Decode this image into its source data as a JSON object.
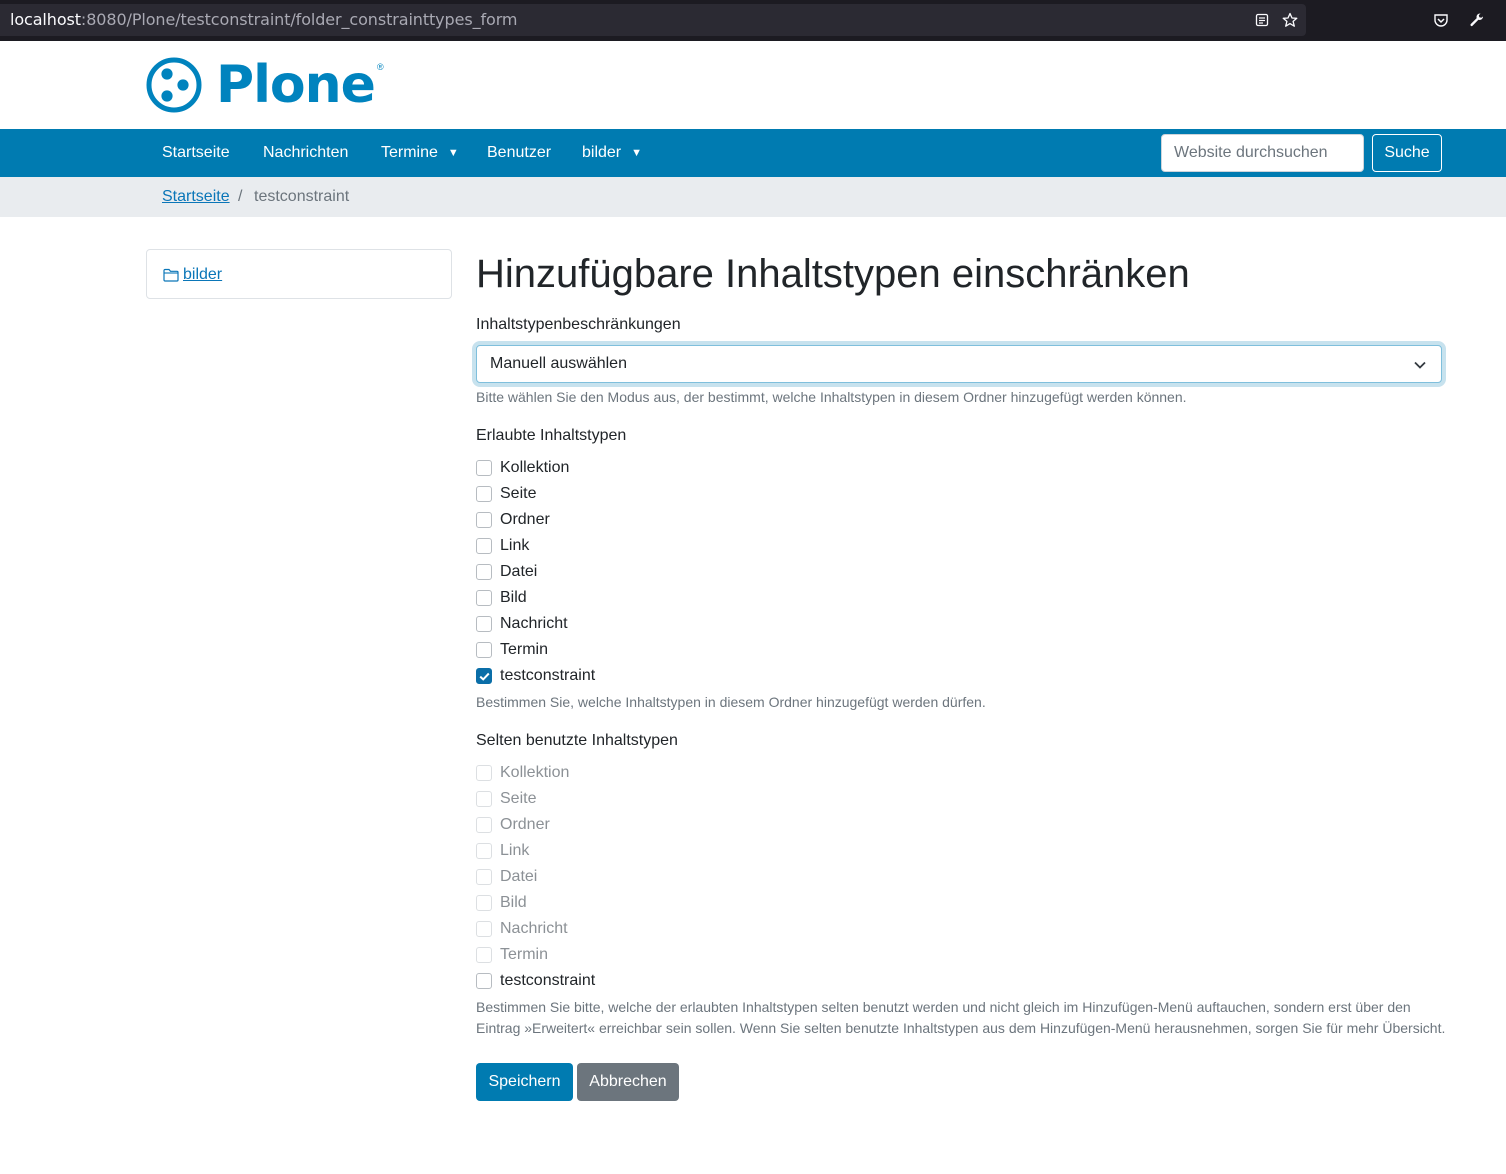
{
  "browser": {
    "url_host": "localhost",
    "url_path": ":8080/Plone/testconstraint/folder_constrainttypes_form"
  },
  "header": {
    "logo_text": "Plone",
    "logo_mark": "®"
  },
  "nav": {
    "items": [
      {
        "label": "Startseite",
        "dropdown": false
      },
      {
        "label": "Nachrichten",
        "dropdown": false
      },
      {
        "label": "Termine",
        "dropdown": true
      },
      {
        "label": "Benutzer",
        "dropdown": false
      },
      {
        "label": "bilder",
        "dropdown": true
      }
    ],
    "caret": "▼",
    "search_placeholder": "Website durchsuchen",
    "search_button": "Suche"
  },
  "breadcrumb": {
    "home": "Startseite",
    "separator": "/",
    "current": "testconstraint"
  },
  "portlet": {
    "link": "bilder"
  },
  "main": {
    "title": "Hinzufügbare Inhaltstypen einschränken",
    "constraint_label": "Inhaltstypenbeschränkungen",
    "constraint_value": "Manuell auswählen",
    "constraint_help": "Bitte wählen Sie den Modus aus, der bestimmt, welche Inhaltstypen in diesem Ordner hinzugefügt werden können.",
    "allowed_label": "Erlaubte Inhaltstypen",
    "allowed_items": [
      {
        "label": "Kollektion",
        "checked": false
      },
      {
        "label": "Seite",
        "checked": false
      },
      {
        "label": "Ordner",
        "checked": false
      },
      {
        "label": "Link",
        "checked": false
      },
      {
        "label": "Datei",
        "checked": false
      },
      {
        "label": "Bild",
        "checked": false
      },
      {
        "label": "Nachricht",
        "checked": false
      },
      {
        "label": "Termin",
        "checked": false
      },
      {
        "label": "testconstraint",
        "checked": true
      }
    ],
    "allowed_help": "Bestimmen Sie, welche Inhaltstypen in diesem Ordner hinzugefügt werden dürfen.",
    "secondary_label": "Selten benutzte Inhaltstypen",
    "secondary_items": [
      {
        "label": "Kollektion",
        "disabled": true
      },
      {
        "label": "Seite",
        "disabled": true
      },
      {
        "label": "Ordner",
        "disabled": true
      },
      {
        "label": "Link",
        "disabled": true
      },
      {
        "label": "Datei",
        "disabled": true
      },
      {
        "label": "Bild",
        "disabled": true
      },
      {
        "label": "Nachricht",
        "disabled": true
      },
      {
        "label": "Termin",
        "disabled": true
      },
      {
        "label": "testconstraint",
        "disabled": false
      }
    ],
    "secondary_help_line1": "Bestimmen Sie bitte, welche der erlaubten Inhaltstypen selten benutzt werden und nicht gleich im Hinzufügen-Menü auftauchen, sondern erst über den",
    "secondary_help_line2": "Eintrag »Erweitert« erreichbar sein sollen. Wenn Sie selten benutzte Inhaltstypen aus dem Hinzufügen-Menü herausnehmen, sorgen Sie für mehr Übersicht.",
    "save_button": "Speichern",
    "cancel_button": "Abbrechen"
  },
  "colors": {
    "brand": "#0083be",
    "navbar": "#007bb1",
    "checked": "#0a6ea8",
    "secondary_button": "#6c757d"
  }
}
